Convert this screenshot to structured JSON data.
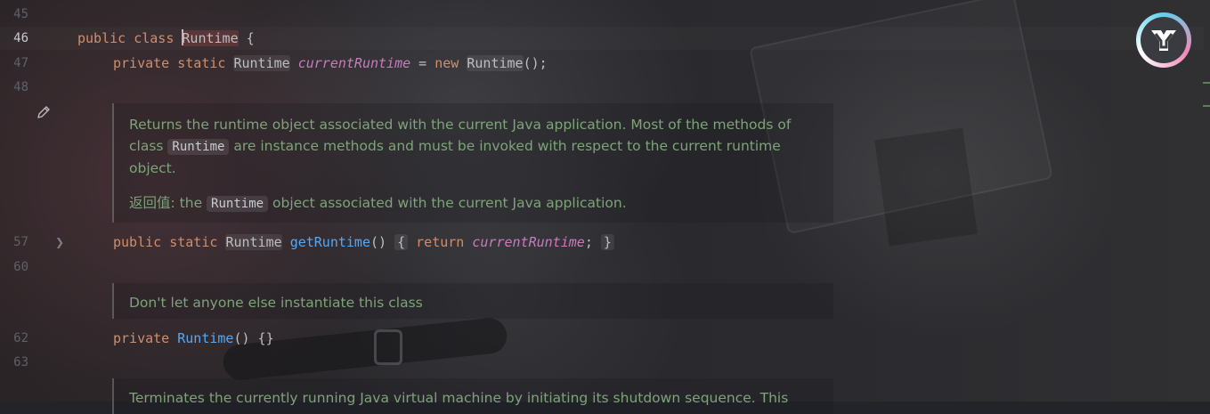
{
  "gutter": {
    "line_numbers": [
      "45",
      "46",
      "47",
      "48",
      "57",
      "60",
      "62",
      "63"
    ],
    "active_line": "46"
  },
  "code": {
    "line46": {
      "kw1": "public",
      "kw2": "class",
      "type": "Runtime",
      "rest": " {"
    },
    "line47": {
      "kw1": "private",
      "kw2": "static",
      "type": "Runtime",
      "field": "currentRuntime",
      "eq": " = ",
      "kw3": "new",
      "type2": "Runtime",
      "rest": "();"
    },
    "line57": {
      "kw1": "public",
      "kw2": "static",
      "type": "Runtime",
      "fn": "getRuntime",
      "parens": "()",
      "open": "{",
      "kw3": "return",
      "field": "currentRuntime",
      "semi": ";",
      "close": "}"
    },
    "line62": {
      "kw1": "private",
      "ctor": "Runtime",
      "rest": "() {}"
    }
  },
  "docs": {
    "doc1": {
      "line1": "Returns the runtime object associated with the current Java application. Most of the methods of",
      "line2_pre": "class",
      "line2_code": "Runtime",
      "line2_post": "are instance methods and must be invoked with respect to the current runtime",
      "line3": "object.",
      "returns_label": "返回值:",
      "returns_pre": "the",
      "returns_code": "Runtime",
      "returns_post": "object associated with the current Java application."
    },
    "doc2": {
      "text": "Don't let anyone else instantiate this class"
    },
    "doc3": {
      "text": "Terminates the currently running Java virtual machine by initiating its shutdown sequence. This"
    }
  },
  "icons": {
    "edit": "pencil-icon",
    "fold": "chevron-right-icon",
    "plugin": "toolbox-logo-icon"
  },
  "colors": {
    "keyword": "#cf8e6d",
    "field": "#c77dbb",
    "function": "#56a8f5",
    "doc_text": "#7ea27a",
    "text": "#bcbec4"
  }
}
